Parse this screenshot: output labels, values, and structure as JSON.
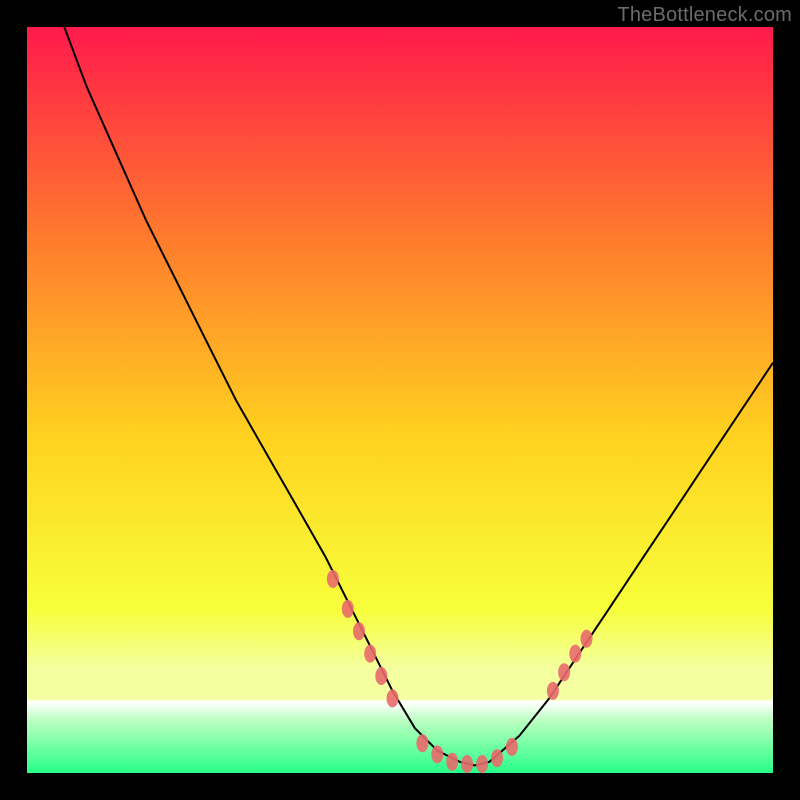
{
  "watermark": "TheBottleneck.com",
  "colors": {
    "black": "#000000",
    "curve": "#000000",
    "marker_fill": "#e96a6c",
    "marker_stroke": "#e96a6c",
    "grad_top": "#ff1a4b",
    "grad_mid_upper": "#ff7a2d",
    "grad_mid": "#ffd21f",
    "grad_mid_lower": "#f7ff3a",
    "grad_band": "#f4ffa0",
    "grad_bottom": "#27ff88"
  },
  "chart_data": {
    "type": "line",
    "title": "",
    "xlabel": "",
    "ylabel": "",
    "x_range": [
      0,
      100
    ],
    "y_range": [
      0,
      100
    ],
    "gradient_stops": [
      {
        "offset": 0.0,
        "color": "#ff1a4b"
      },
      {
        "offset": 0.28,
        "color": "#ff7a2d"
      },
      {
        "offset": 0.55,
        "color": "#ffd21f"
      },
      {
        "offset": 0.78,
        "color": "#f7ff3a"
      },
      {
        "offset": 0.86,
        "color": "#f4ffa0"
      },
      {
        "offset": 0.9,
        "color": "#f4ffa0"
      },
      {
        "offset": 0.905,
        "color": "#ffffff"
      },
      {
        "offset": 0.93,
        "color": "#baffc0"
      },
      {
        "offset": 1.0,
        "color": "#27ff88"
      }
    ],
    "series": [
      {
        "name": "bottleneck-curve",
        "x": [
          5,
          8,
          12,
          16,
          20,
          24,
          28,
          32,
          36,
          40,
          43,
          46,
          49,
          52,
          55,
          58,
          60,
          62,
          66,
          70,
          74,
          78,
          82,
          86,
          90,
          94,
          98,
          100
        ],
        "y": [
          100,
          92,
          83,
          74,
          66,
          58,
          50,
          43,
          36,
          29,
          23,
          17,
          11,
          6,
          3,
          1.5,
          1,
          1.5,
          5,
          10,
          16,
          22,
          28,
          34,
          40,
          46,
          52,
          55
        ]
      }
    ],
    "markers": [
      {
        "x": 41.0,
        "y": 26.0
      },
      {
        "x": 43.0,
        "y": 22.0
      },
      {
        "x": 44.5,
        "y": 19.0
      },
      {
        "x": 46.0,
        "y": 16.0
      },
      {
        "x": 47.5,
        "y": 13.0
      },
      {
        "x": 49.0,
        "y": 10.0
      },
      {
        "x": 53.0,
        "y": 4.0
      },
      {
        "x": 55.0,
        "y": 2.5
      },
      {
        "x": 57.0,
        "y": 1.5
      },
      {
        "x": 59.0,
        "y": 1.2
      },
      {
        "x": 61.0,
        "y": 1.2
      },
      {
        "x": 63.0,
        "y": 2.0
      },
      {
        "x": 65.0,
        "y": 3.5
      },
      {
        "x": 70.5,
        "y": 11.0
      },
      {
        "x": 72.0,
        "y": 13.5
      },
      {
        "x": 73.5,
        "y": 16.0
      },
      {
        "x": 75.0,
        "y": 18.0
      }
    ]
  }
}
